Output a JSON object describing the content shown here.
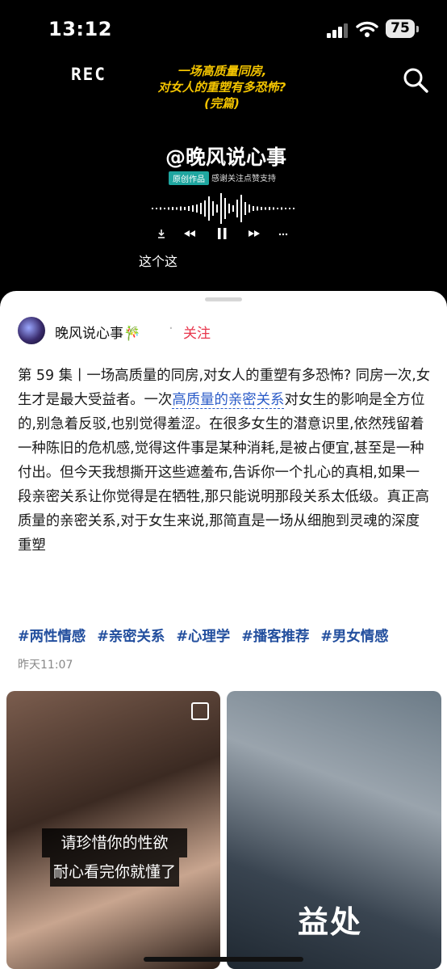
{
  "status_bar": {
    "time": "13:12",
    "battery": "75"
  },
  "video": {
    "rec_label": "REC",
    "title_lines": [
      "一场高质量同房,",
      "对女人的重塑有多恐怖?",
      "(完篇)"
    ],
    "brand": "@晚风说心事",
    "tag_original": "原创作品",
    "tag_thanks": "感谢关注点赞支持",
    "subtitle": "这个这"
  },
  "post": {
    "author": "晚风说心事🎋",
    "follow_label": "关注",
    "description_before": "第 59 集丨一场高质量的同房,对女人的重塑有多恐怖? 同房一次,女生才是最大受益者。一次",
    "description_link": "高质量的亲密关系",
    "description_after": "对女生的影响是全方位的,别急着反驳,也别觉得羞涩。在很多女生的潜意识里,依然残留着一种陈旧的危机感,觉得这件事是某种消耗,是被占便宜,甚至是一种付出。但今天我想撕开这些遮羞布,告诉你一个扎心的真相,如果一段亲密关系让你觉得是在牺牲,那只能说明那段关系太低级。真正高质量的亲密关系,对于女生来说,那简直是一场从细胞到灵魂的深度重塑",
    "hashtags": [
      "#两性情感",
      "#亲密关系",
      "#心理学",
      "#播客推荐",
      "#男女情感"
    ],
    "timestamp": "昨天11:07"
  },
  "images": {
    "first_caption_line1": "请珍惜你的性欲",
    "first_caption_line2": "耐心看完你就懂了",
    "second_caption": "益处"
  },
  "icons": [
    "search-icon",
    "signal-icon",
    "wifi-icon",
    "battery-icon",
    "download-icon",
    "rewind-icon",
    "pause-icon",
    "forward-icon",
    "more-icon",
    "multi-image-icon"
  ]
}
